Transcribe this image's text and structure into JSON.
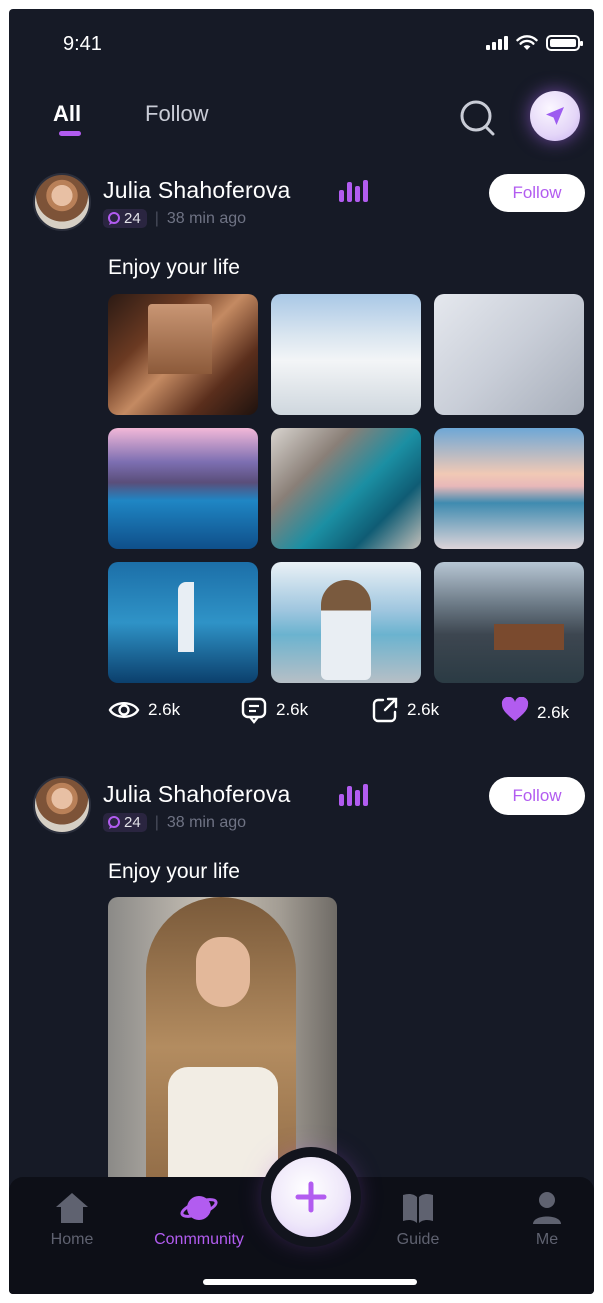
{
  "status_bar": {
    "time": "9:41"
  },
  "tabs": [
    {
      "label": "All",
      "active": true
    },
    {
      "label": "Follow",
      "active": false
    }
  ],
  "header_icons": [
    "search-icon",
    "send-icon"
  ],
  "posts": [
    {
      "author": "Julia Shahoferova",
      "badge_count": "24",
      "time_ago": "38 min ago",
      "follow_label": "Follow",
      "caption": "Enjoy your life",
      "photos": [
        "petra-canyon",
        "santorini",
        "map-pins",
        "mountain-lake",
        "coastal-cliffs",
        "beach-sunset",
        "burj-al-arab",
        "photographer",
        "mountain-cabin"
      ],
      "stats": {
        "views": "2.6k",
        "comments": "2.6k",
        "shares": "2.6k",
        "likes": "2.6k"
      }
    },
    {
      "author": "Julia Shahoferova",
      "badge_count": "24",
      "time_ago": "38 min ago",
      "follow_label": "Follow",
      "caption": "Enjoy your life"
    }
  ],
  "bottom_nav": [
    {
      "label": "Home",
      "icon": "home-icon",
      "active": false
    },
    {
      "label": "Conmmunity",
      "icon": "planet-icon",
      "active": true
    },
    {
      "label": "Guide",
      "icon": "book-icon",
      "active": false
    },
    {
      "label": "Me",
      "icon": "user-icon",
      "active": false
    }
  ],
  "colors": {
    "accent": "#b25cf0",
    "background": "#161a26",
    "nav_background": "#0d0f17"
  }
}
